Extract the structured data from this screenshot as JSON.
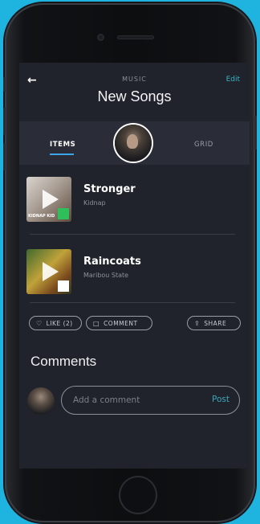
{
  "header": {
    "back_icon": "arrow-left-icon",
    "section": "MUSIC",
    "edit": "Edit",
    "title": "New Songs"
  },
  "tabs": {
    "items": "ITEMS",
    "grid": "GRID"
  },
  "songs": [
    {
      "title": "Stronger",
      "artist": "Kidnap",
      "thumb_text": "KIDNAP KID"
    },
    {
      "title": "Raincoats",
      "artist": "Maribou State"
    }
  ],
  "actions": {
    "like": "LIKE (2)",
    "comment": "COMMENT",
    "share": "SHARE"
  },
  "comments": {
    "title": "Comments",
    "placeholder": "Add a comment",
    "post": "Post"
  },
  "colors": {
    "accent": "#36b3c4",
    "tab_accent": "#3aa6e8",
    "screen_bg": "#21232c",
    "page_bg": "#1fb4e0"
  }
}
